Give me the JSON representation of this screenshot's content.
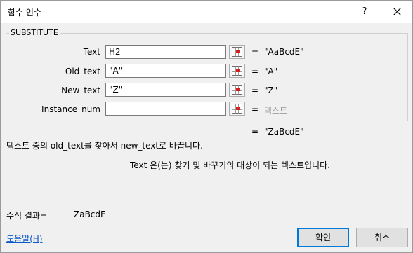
{
  "window": {
    "title": "함수 인수",
    "help_glyph": "?",
    "close_icon": "close-icon"
  },
  "function_name": "SUBSTITUTE",
  "arguments": [
    {
      "label": "Text",
      "value": "H2",
      "result": "\"AaBcdE\"",
      "eq": "="
    },
    {
      "label": "Old_text",
      "value": "\"A\"",
      "result": "\"A\"",
      "eq": "="
    },
    {
      "label": "New_text",
      "value": "\"Z\"",
      "result": "\"Z\"",
      "eq": "="
    },
    {
      "label": "Instance_num",
      "value": "",
      "result": "텍스트",
      "eq": "="
    }
  ],
  "function_result": {
    "eq": "=",
    "value": "\"ZaBcdE\""
  },
  "description": {
    "function": "텍스트 중의 old_text를 찾아서 new_text로 바꿉니다.",
    "argument": "Text  은(는) 찾기 및 바꾸기의 대상이 되는 텍스트입니다."
  },
  "formula_result": {
    "label": "수식 결과=",
    "value": "ZaBcdE"
  },
  "help_link": "도움말(H)",
  "buttons": {
    "ok": "확인",
    "cancel": "취소"
  },
  "colors": {
    "focus_border": "#0078d7",
    "link": "#0b59c6"
  }
}
